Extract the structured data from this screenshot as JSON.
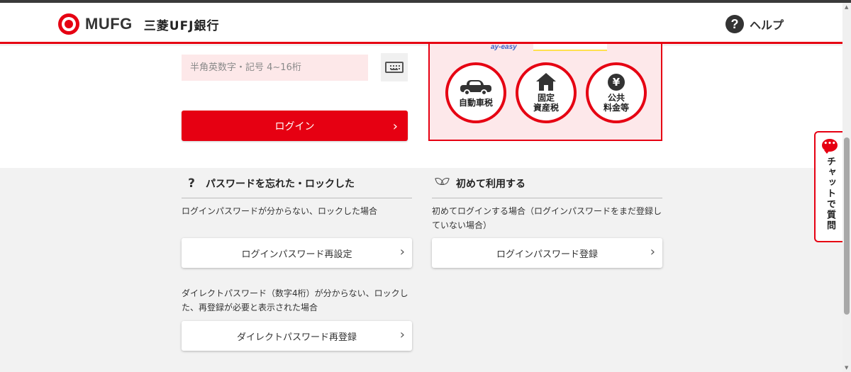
{
  "header": {
    "logo_text": "MUFG",
    "bank_name": "三菱UFJ銀行",
    "help_label": "ヘルプ",
    "help_icon_glyph": "?"
  },
  "login": {
    "password_placeholder": "半角英数字・記号 4~16桁",
    "password_value": "",
    "login_label": "ログイン",
    "chevron": "›"
  },
  "tax_panel": {
    "payeasy_label": "ay-easy",
    "items": [
      {
        "label": "自動車税",
        "icon": "car-icon"
      },
      {
        "label": "固定\n資産税",
        "icon": "house-icon"
      },
      {
        "label": "公共\n料金等",
        "icon": "yen-icon",
        "glyph": "¥"
      }
    ]
  },
  "forgot": {
    "icon_glyph": "?",
    "title": "パスワードを忘れた・ロックした",
    "desc1": "ログインパスワードが分からない、ロックした場合",
    "button1": "ログインパスワード再設定",
    "desc2": "ダイレクトパスワード（数字4桁）が分からない、ロックした、再登録が必要と表示された場合",
    "button2": "ダイレクトパスワード再登録"
  },
  "first_time": {
    "title": "初めて利用する",
    "desc": "初めてログインする場合（ログインパスワードをまだ登録していない場合）",
    "button": "ログインパスワード登録"
  },
  "chat": {
    "label": "チャットで質問",
    "bubble_glyph": "•••"
  },
  "colors": {
    "brand_red": "#e60012",
    "input_bg": "#fde8e9",
    "panel_bg": "#fde8ea",
    "page_bg": "#f2f2f2"
  }
}
